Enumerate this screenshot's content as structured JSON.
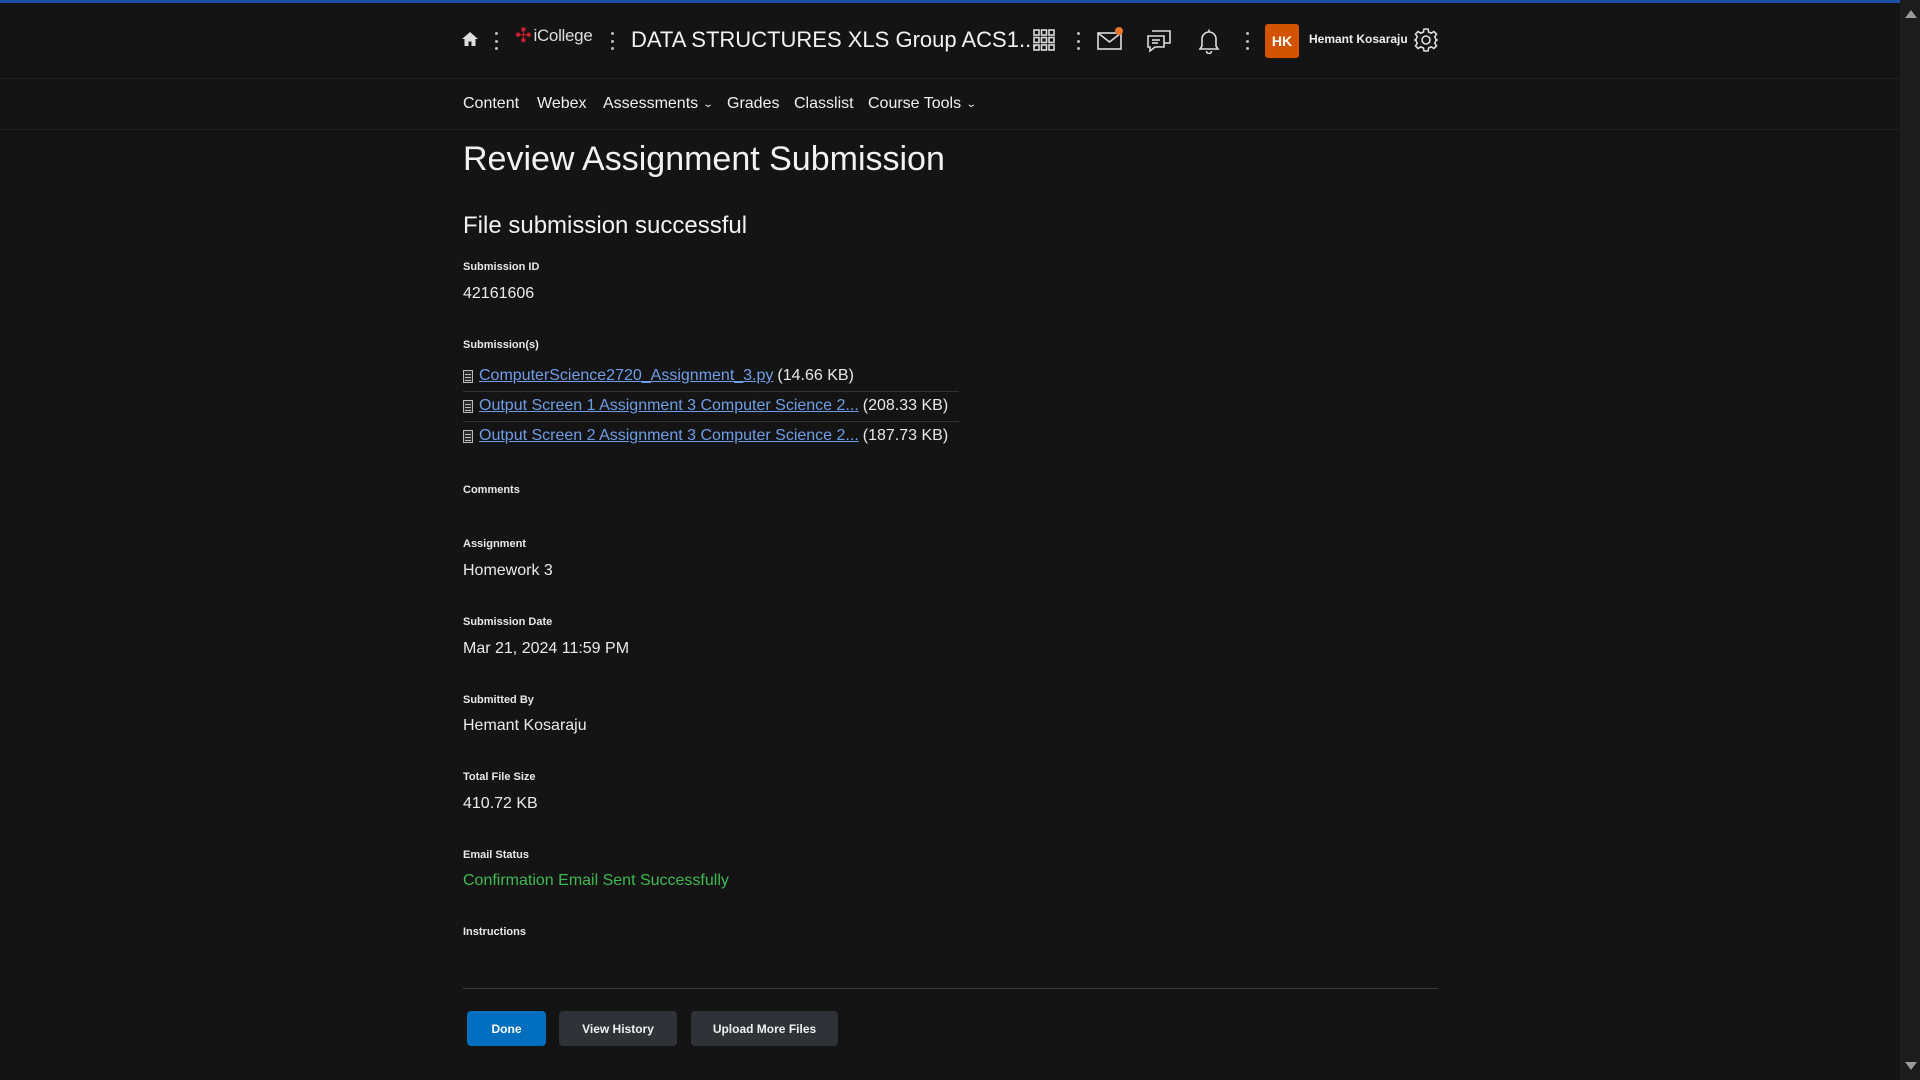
{
  "header": {
    "logo_text": "iCollege",
    "course_title": "DATA STRUCTURES XLS Group ACS1...",
    "avatar_initials": "HK",
    "user_name": "Hemant Kosaraju",
    "colors": {
      "avatar": "#d35400",
      "notification_dot": "#e8772e",
      "top_accent": "#1d4fa8"
    }
  },
  "nav": {
    "items": [
      {
        "label": "Content"
      },
      {
        "label": "Webex"
      },
      {
        "label": "Assessments"
      },
      {
        "label": "Grades"
      },
      {
        "label": "Classlist"
      },
      {
        "label": "Course Tools"
      }
    ]
  },
  "page": {
    "title": "Review Assignment Submission",
    "status_heading": "File submission successful"
  },
  "details": {
    "submission_id_label": "Submission ID",
    "submission_id": "42161606",
    "submissions_label": "Submission(s)",
    "files": [
      {
        "name": "ComputerScience2720_Assignment_3.py",
        "size": "(14.66 KB)"
      },
      {
        "name": "Output Screen 1 Assignment 3 Computer Science 2...",
        "size": "(208.33 KB)"
      },
      {
        "name": "Output Screen 2 Assignment 3 Computer Science 2...",
        "size": "(187.73 KB)"
      }
    ],
    "comments_label": "Comments",
    "assignment_label": "Assignment",
    "assignment": "Homework 3",
    "submission_date_label": "Submission Date",
    "submission_date": "Mar 21, 2024 11:59 PM",
    "submitted_by_label": "Submitted By",
    "submitted_by": "Hemant Kosaraju",
    "total_size_label": "Total File Size",
    "total_size": "410.72 KB",
    "email_status_label": "Email Status",
    "email_status": "Confirmation Email Sent Successfully",
    "email_status_color": "#3fb950",
    "instructions_label": "Instructions"
  },
  "actions": {
    "done": "Done",
    "view_history": "View History",
    "upload_more": "Upload More Files"
  },
  "icons": {
    "home": "home-icon",
    "apps": "grid-icon",
    "mail": "mail-icon",
    "chat": "chat-icon",
    "notifications": "bell-icon",
    "settings": "gear-icon",
    "file": "file-icon"
  }
}
